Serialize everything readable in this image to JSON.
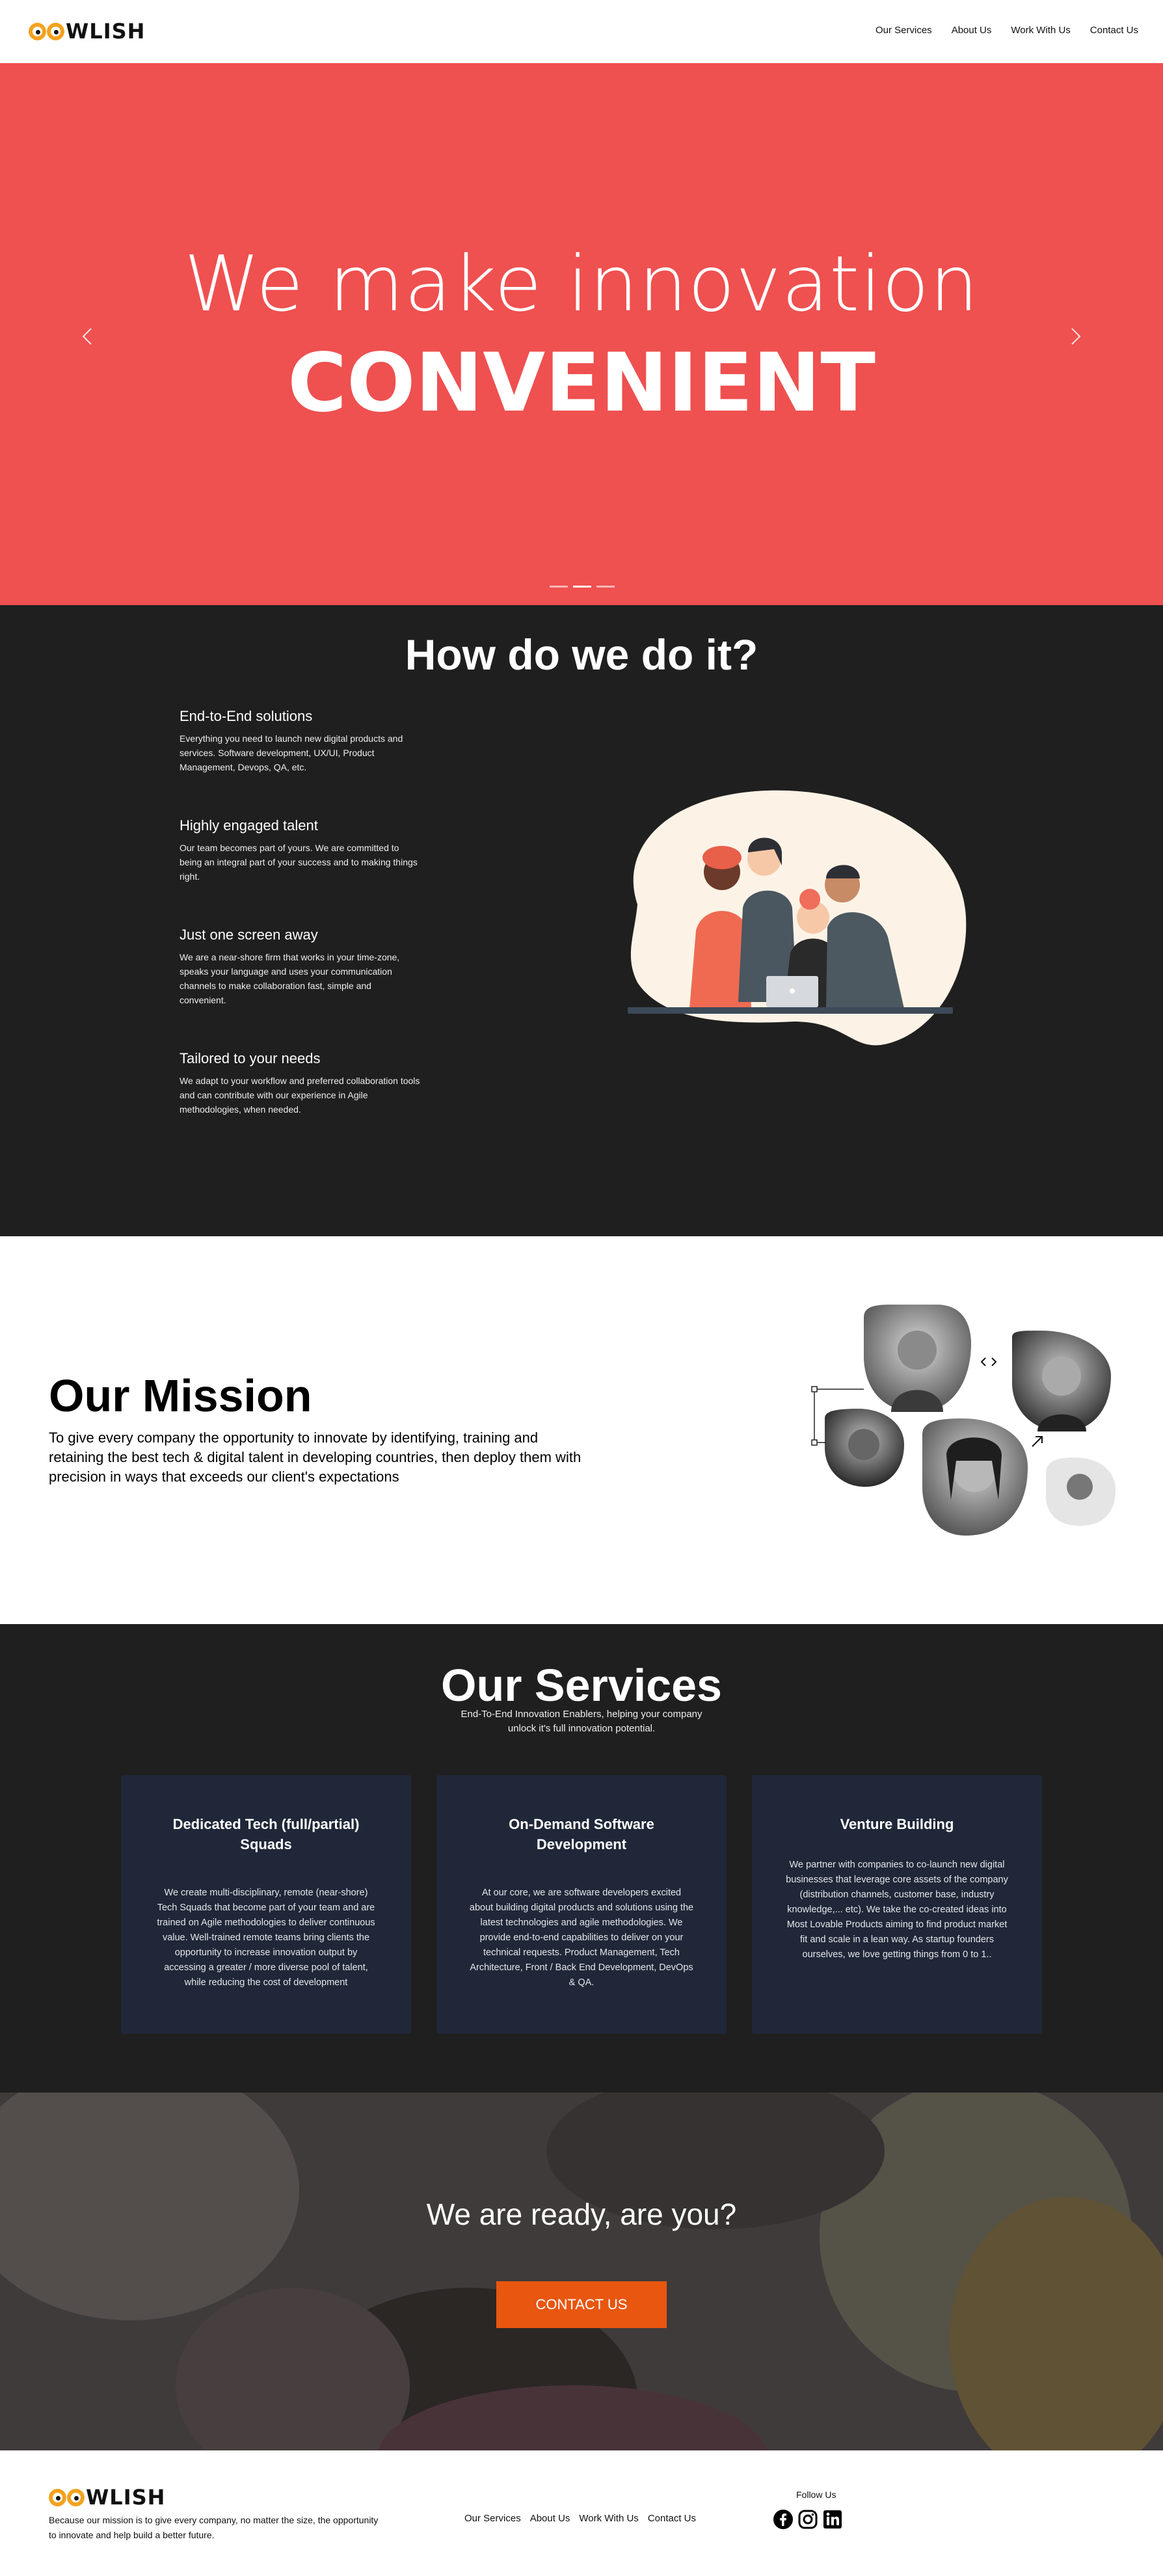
{
  "brand": {
    "logo_text": "WLISH",
    "eye_color": "#f4a21f"
  },
  "nav": [
    "Our Services",
    "About Us",
    "Work With Us",
    "Contact Us"
  ],
  "hero": {
    "line1": "We make innovation",
    "line2": "CONVENIENT",
    "background": "#ef5050",
    "prev_icon": "chevron-left-icon",
    "next_icon": "chevron-right-icon",
    "slide_count": 3,
    "active_slide": 2
  },
  "how": {
    "title": "How do we do it?",
    "features": [
      {
        "title": "End-to-End solutions",
        "text": "Everything you need to launch new digital products and services. Software development, UX/UI, Product Management, Devops, QA, etc."
      },
      {
        "title": "Highly engaged talent",
        "text": "Our team becomes part of yours. We are committed to being an integral part of your success and to making things right."
      },
      {
        "title": "Just one screen away",
        "text": "We are a near-shore firm that works in your time-zone, speaks your language and uses your communication channels to make collaboration fast, simple and convenient."
      },
      {
        "title": "Tailored to your needs",
        "text": "We adapt to your workflow and preferred collaboration tools and can contribute with our experience in Agile methodologies, when needed."
      }
    ]
  },
  "mission": {
    "title": "Our Mission",
    "text": "To give every company the opportunity to innovate by identifying, training and retaining the best tech & digital talent in developing countries, then deploy them with precision in ways that exceeds our client's expectations"
  },
  "services": {
    "title": "Our Services",
    "subtitle": "End-To-End Innovation Enablers, helping your company unlock it's full innovation potential.",
    "cards": [
      {
        "title": "Dedicated Tech (full/partial) Squads",
        "text": "We create multi-disciplinary, remote (near-shore) Tech Squads that become part of your team and are trained on Agile methodologies to deliver continuous value. Well-trained remote teams bring clients the opportunity to increase innovation output by accessing a greater / more diverse pool of talent, while reducing the cost of development"
      },
      {
        "title": "On-Demand Software Development",
        "text": "At our core, we are software developers excited about building digital products and solutions using the latest technologies and agile methodologies. We provide end-to-end capabilities to deliver on your technical requests. Product Management, Tech Architecture, Front / Back End Development, DevOps & QA."
      },
      {
        "title": "Venture Building",
        "text": "We partner with companies to co-launch new digital businesses that leverage core assets of the company (distribution channels, customer base, industry knowledge,... etc). We take the co-created ideas into Most Lovable Products aiming to find product market fit and scale in a lean way. As startup founders ourselves, we love getting things from 0 to 1.."
      }
    ],
    "card_color": "#1f2738"
  },
  "cta": {
    "title": "We are ready, are you?",
    "button": "CONTACT US",
    "button_color": "#e8560f"
  },
  "footer": {
    "description": "Because our mission is to give every company, no matter the size, the opportunity to innovate and help build a better future.",
    "nav": [
      "Our Services",
      "About Us",
      "Work With Us",
      "Contact Us"
    ],
    "follow_label": "Follow Us",
    "socials": [
      "facebook-icon",
      "instagram-icon",
      "linkedin-icon"
    ]
  }
}
